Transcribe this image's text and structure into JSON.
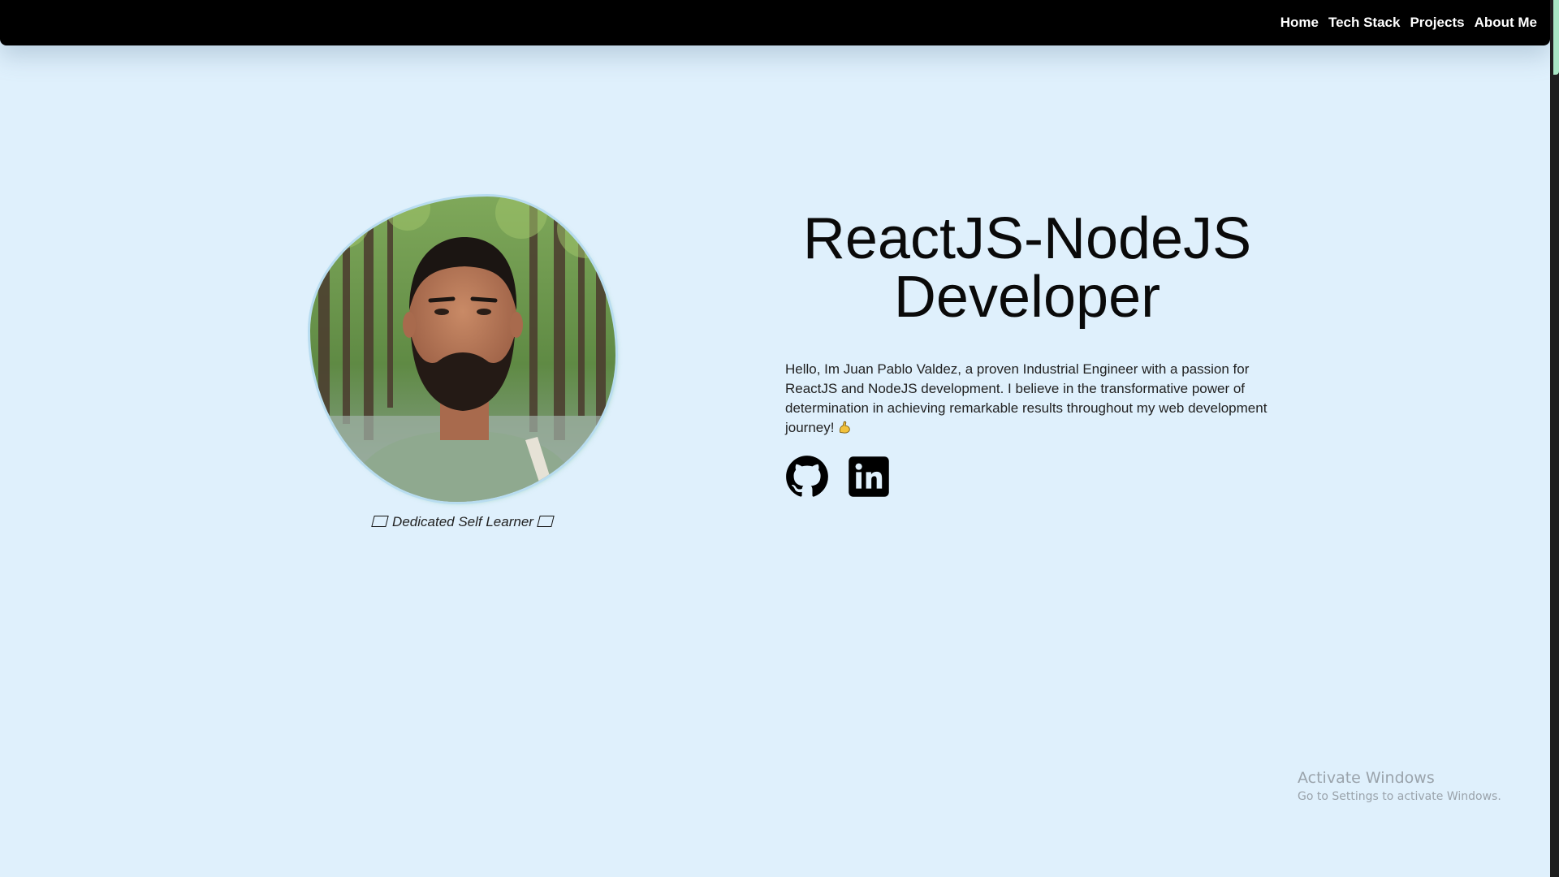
{
  "nav": {
    "items": [
      {
        "label": "Home"
      },
      {
        "label": "Tech Stack"
      },
      {
        "label": "Projects"
      },
      {
        "label": "About Me"
      }
    ]
  },
  "hero": {
    "title_line1": "ReactJS-NodeJS",
    "title_line2": "Developer",
    "bio": "Hello, Im Juan Pablo Valdez, a proven Industrial Engineer with a passion for ReactJS and NodeJS development. I believe in the transformative power of determination in achieving remarkable results throughout my web development journey!",
    "caption": "Dedicated Self Learner"
  },
  "socials": [
    {
      "icon": "github-icon"
    },
    {
      "icon": "linkedin-icon"
    }
  ],
  "watermark": {
    "title": "Activate Windows",
    "subtitle": "Go to Settings to activate Windows."
  },
  "colors": {
    "background": "#dff0fc",
    "navbar": "#000000",
    "text": "#0a0a0a",
    "scroll_thumb": "#a8e6c4"
  }
}
